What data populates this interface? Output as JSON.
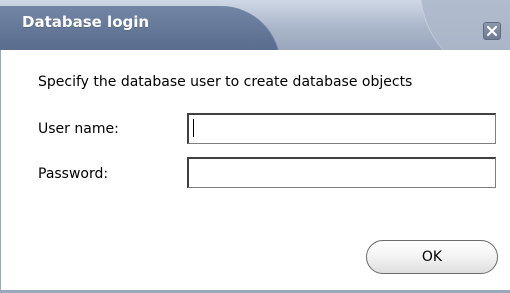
{
  "dialog": {
    "title": "Database login",
    "close_icon": "close-icon",
    "instruction": "Specify the database user to create database objects",
    "fields": {
      "user_name_label": "User name:",
      "user_name_value": "",
      "password_label": "Password:",
      "password_value": ""
    },
    "ok_label": "OK"
  },
  "colors": {
    "title_dark": "#5e7091",
    "title_light": "#aab6c9",
    "border": "#9aa7bc"
  }
}
